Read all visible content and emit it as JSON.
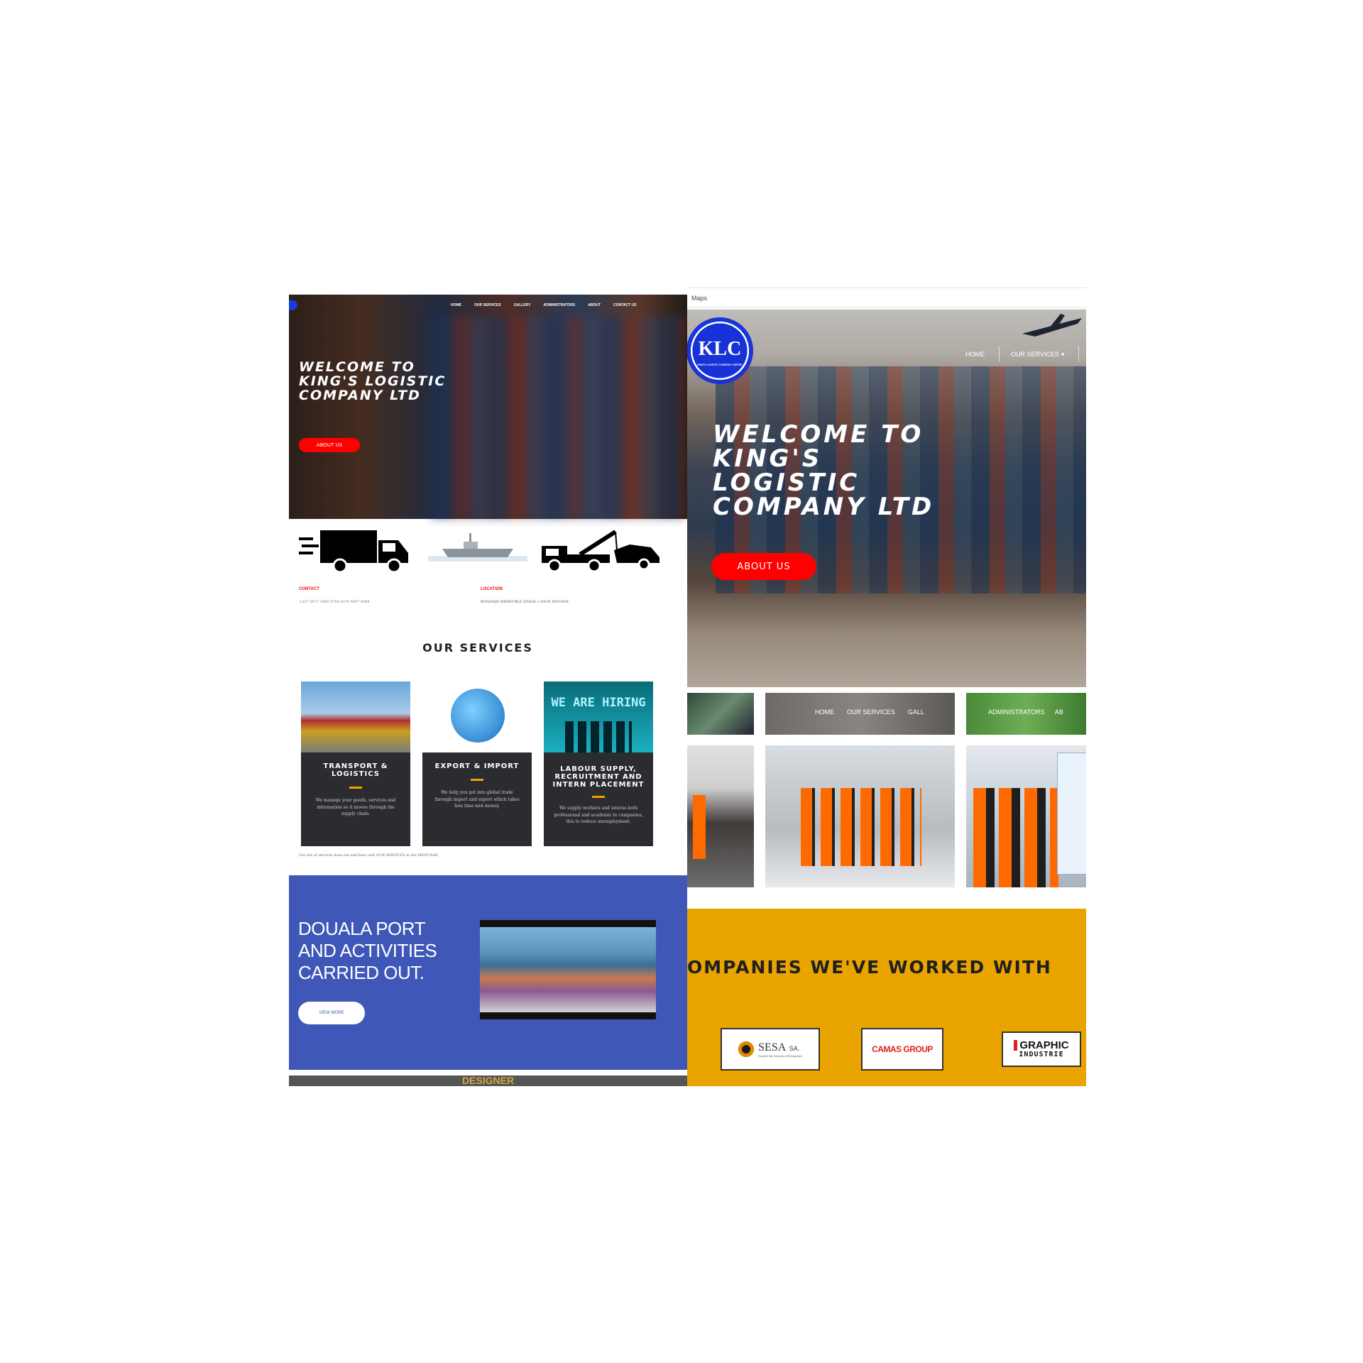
{
  "left": {
    "nav": [
      "HOME",
      "OUR SERVICES",
      "GALLERY",
      "ADMINISTRATORS",
      "ABOUT",
      "CONTACT US"
    ],
    "hero": {
      "title": "WELCOME TO KING'S LOGISTIC COMPANY LTD",
      "button": "ABOUT US"
    },
    "info": {
      "contact_label": "CONTACT",
      "contact_value": "+237 6977 3560 6754 6374 6907 4468",
      "location_label": "LOCATION",
      "location_value": "BONANJO IMMEUBLE ETAGE 2 FACE DOUANE"
    },
    "services_heading": "OUR SERVICES",
    "services": [
      {
        "title": "TRANSPORT & LOGISTICS",
        "text": "We manage your goods, services and information so it moves through the supply chain."
      },
      {
        "title": "EXPORT & IMPORT",
        "text": "We help you get into global trade through import and export which takes less time and money."
      },
      {
        "title": "LABOUR SUPPLY, RECRUITMENT AND INTERN PLACEMENT",
        "text": "We supply workers and interns both professional and academic to companies, this to reduce unemployment."
      }
    ],
    "hiring_banner": "WE ARE HIRING",
    "services_footer": "Our list of services does not end here visit OUR SERVICES in the MENUBAR",
    "douala": {
      "title": "DOUALA PORT AND ACTIVITIES CARRIED OUT.",
      "button": "VIEW MORE"
    },
    "bottom_peek": "DESIGNER"
  },
  "right": {
    "tab_label": "Maps",
    "logo_text": "KLC",
    "logo_sub": "KING'S LOGISTIC COMPANY LIMITED",
    "nav": {
      "home": "HOME",
      "services": "OUR SERVICES"
    },
    "hero": {
      "title": "WELCOME TO KING'S LOGISTIC COMPANY LTD",
      "button": "ABOUT US"
    },
    "strip_nav": [
      "HOME",
      "OUR SERVICES",
      "GALL",
      "ADMINISTRATORS",
      "AB"
    ],
    "companies_heading": "OMPANIES WE'VE WORKED WITH",
    "companies": [
      {
        "name": "SESA",
        "suffix": "SA.",
        "tagline": "Société des Services d'Entreprises"
      },
      {
        "name": "CAMAS GROUP"
      },
      {
        "name": "GRAPHIC",
        "line2": "INDUSTRIE"
      }
    ]
  },
  "colors": {
    "accent_red": "#ff0000",
    "blue_section": "#3f58b8",
    "yellow_section": "#e9a400",
    "card_dark": "#2b2c30",
    "card_accent": "#f0a000"
  }
}
